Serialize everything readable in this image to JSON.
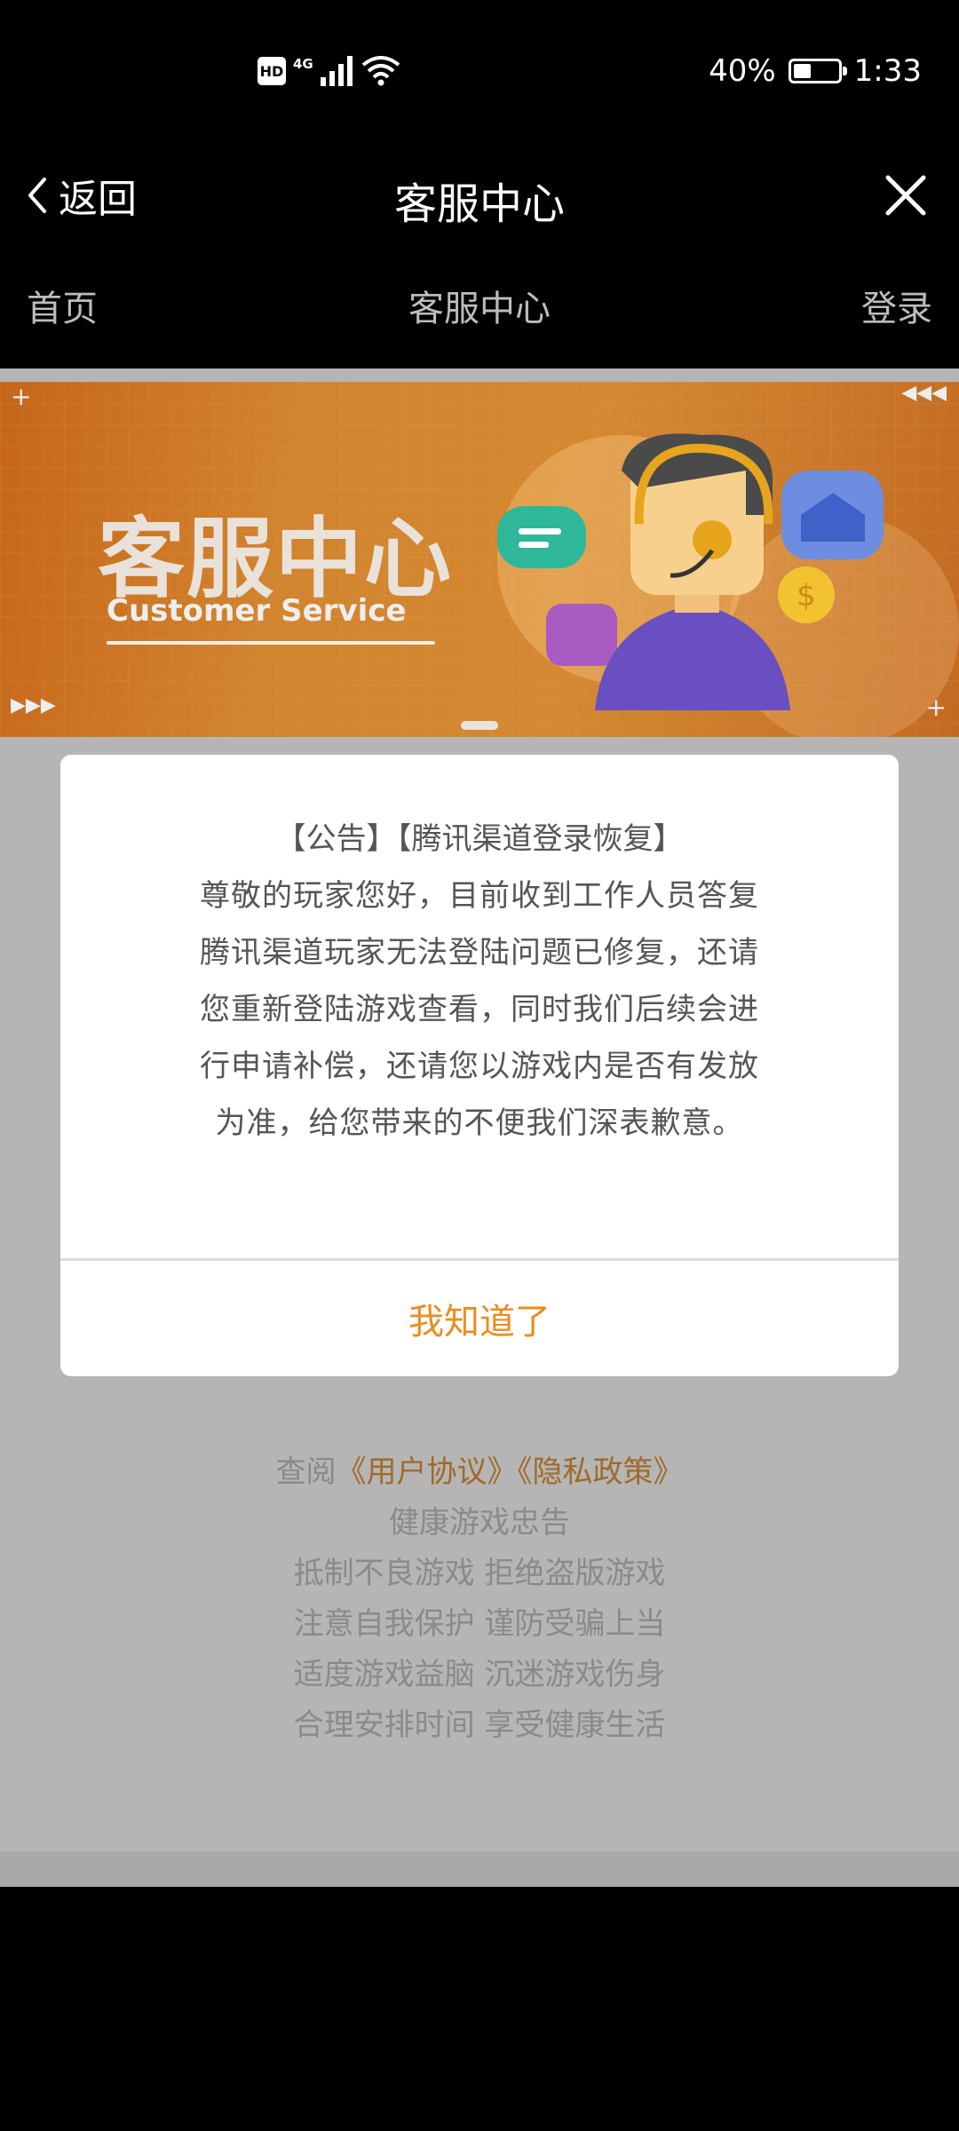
{
  "status_bar": {
    "hd": "HD",
    "network": "4G",
    "battery_percent": "40%",
    "battery_level": 0.4,
    "time": "1:33"
  },
  "title_bar": {
    "back_label": "返回",
    "title": "客服中心",
    "close_icon": "close-icon"
  },
  "nav": {
    "home": "首页",
    "center": "客服中心",
    "login": "登录"
  },
  "banner": {
    "title": "客服中心",
    "subtitle": "Customer Service"
  },
  "modal": {
    "heading": "【公告】【腾讯渠道登录恢复】",
    "body": "尊敬的玩家您好，目前收到工作人员答复腾讯渠道玩家无法登陆问题已修复，还请您重新登陆游戏查看，同时我们后续会进行申请补偿，还请您以游戏内是否有发放为准，给您带来的不便我们深表歉意。",
    "button": "我知道了"
  },
  "footer": {
    "view_prefix": "查阅",
    "user_agreement": "《用户协议》",
    "privacy_policy": "《隐私政策》",
    "health_title": "健康游戏忠告",
    "line1": "抵制不良游戏 拒绝盗版游戏",
    "line2": "注意自我保护 谨防受骗上当",
    "line3": "适度游戏益脑 沉迷游戏伤身",
    "line4": "合理安排时间 享受健康生活"
  },
  "colors": {
    "accent": "#e88e1f",
    "link": "#a06a2a",
    "banner_orange": "#d2842e"
  }
}
